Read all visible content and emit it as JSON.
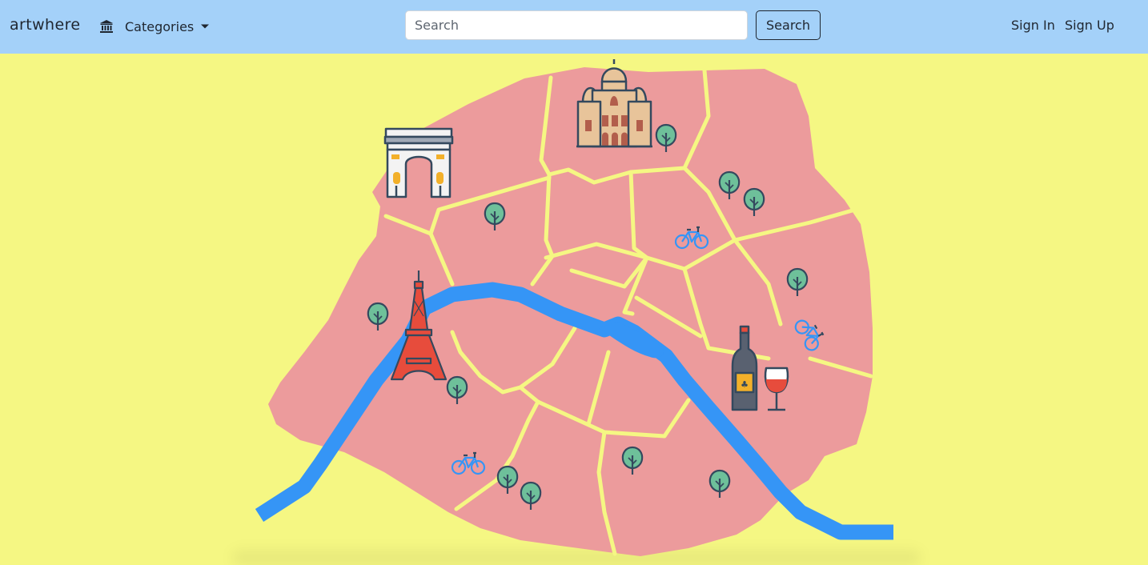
{
  "navbar": {
    "brand": "artwhere",
    "categories_icon": "museum-icon",
    "categories_label": "Categories",
    "search_placeholder": "Search",
    "search_value": "",
    "search_button": "Search",
    "sign_in": "Sign In",
    "sign_up": "Sign Up"
  },
  "hero_map": {
    "subject": "Paris",
    "landmark_icons": [
      "arc-de-triomphe-icon",
      "sacre-coeur-icon",
      "eiffel-tower-icon",
      "wine-bottle-icon",
      "wine-glass-icon"
    ],
    "decor_icons": [
      "tree-icon",
      "bicycle-icon"
    ]
  },
  "colors": {
    "navbar_bg": "#a4d1f9",
    "page_bg": "#f5f783",
    "map_fill": "#ec9b9c",
    "district_lines": "#f5f783",
    "river": "#3595f6",
    "tree": "#6ec09a",
    "outline": "#34495e"
  }
}
